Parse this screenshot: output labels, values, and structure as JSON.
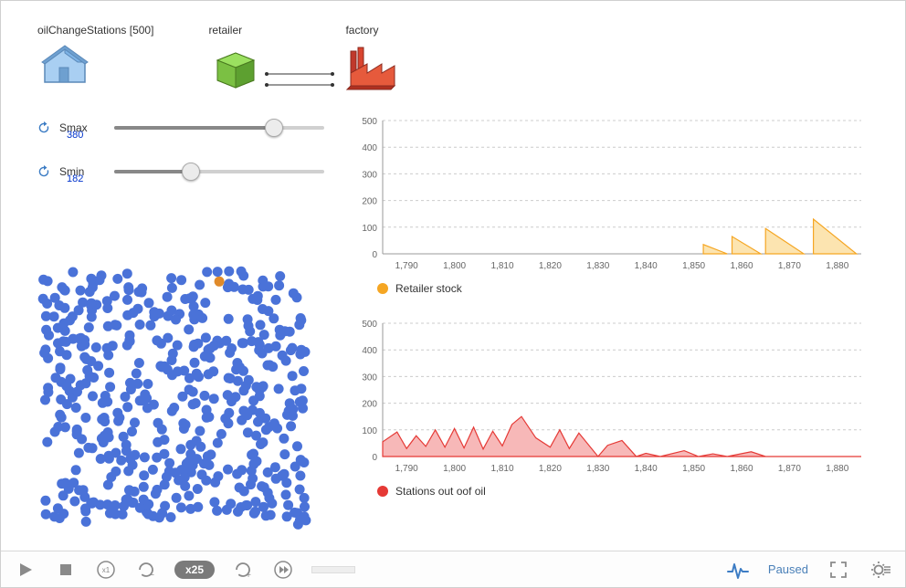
{
  "agents": {
    "oilChangeStations": {
      "label": "oilChangeStations [500]"
    },
    "retailer": {
      "label": "retailer"
    },
    "factory": {
      "label": "factory"
    }
  },
  "sliders": {
    "smax": {
      "label": "Smax",
      "value": 380,
      "min": 0,
      "max": 500,
      "fraction": 0.76
    },
    "smin": {
      "label": "Smin",
      "value": 182,
      "min": 0,
      "max": 500,
      "fraction": 0.364
    }
  },
  "chart_data": [
    {
      "type": "area",
      "title": "Retailer stock",
      "color": "#f5a623",
      "fill": "#fce4b0",
      "ylim": [
        0,
        500
      ],
      "yticks": [
        0,
        100,
        200,
        300,
        400,
        500
      ],
      "xlim": [
        1785,
        1885
      ],
      "xticks": [
        1790,
        1800,
        1810,
        1820,
        1830,
        1840,
        1850,
        1860,
        1870,
        1880
      ],
      "segments": [
        {
          "start": 1852,
          "peak_x": 1852,
          "peak_y": 35,
          "end": 1857
        },
        {
          "start": 1858,
          "peak_x": 1858,
          "peak_y": 65,
          "end": 1864
        },
        {
          "start": 1865,
          "peak_x": 1865,
          "peak_y": 95,
          "end": 1873
        },
        {
          "start": 1875,
          "peak_x": 1875,
          "peak_y": 130,
          "end": 1884
        }
      ]
    },
    {
      "type": "area",
      "title": "Stations out oof oil",
      "color": "#e53935",
      "fill": "#f7b8b8",
      "ylim": [
        0,
        500
      ],
      "yticks": [
        0,
        100,
        200,
        300,
        400,
        500
      ],
      "xlim": [
        1785,
        1885
      ],
      "xticks": [
        1790,
        1800,
        1810,
        1820,
        1830,
        1840,
        1850,
        1860,
        1870,
        1880
      ],
      "points": [
        [
          1785,
          55
        ],
        [
          1788,
          92
        ],
        [
          1790,
          30
        ],
        [
          1792,
          78
        ],
        [
          1794,
          38
        ],
        [
          1796,
          100
        ],
        [
          1798,
          35
        ],
        [
          1800,
          105
        ],
        [
          1802,
          32
        ],
        [
          1804,
          110
        ],
        [
          1806,
          28
        ],
        [
          1808,
          95
        ],
        [
          1810,
          40
        ],
        [
          1812,
          120
        ],
        [
          1814,
          150
        ],
        [
          1817,
          70
        ],
        [
          1820,
          35
        ],
        [
          1822,
          100
        ],
        [
          1824,
          30
        ],
        [
          1826,
          88
        ],
        [
          1830,
          0
        ],
        [
          1832,
          42
        ],
        [
          1835,
          60
        ],
        [
          1838,
          0
        ],
        [
          1840,
          12
        ],
        [
          1843,
          0
        ],
        [
          1848,
          22
        ],
        [
          1851,
          0
        ],
        [
          1854,
          10
        ],
        [
          1857,
          0
        ],
        [
          1862,
          18
        ],
        [
          1865,
          0
        ],
        [
          1885,
          0
        ]
      ]
    }
  ],
  "scatter": {
    "count": 500,
    "highlightIndex": 12
  },
  "toolbar": {
    "speed_label": "x25",
    "status": "Paused"
  }
}
